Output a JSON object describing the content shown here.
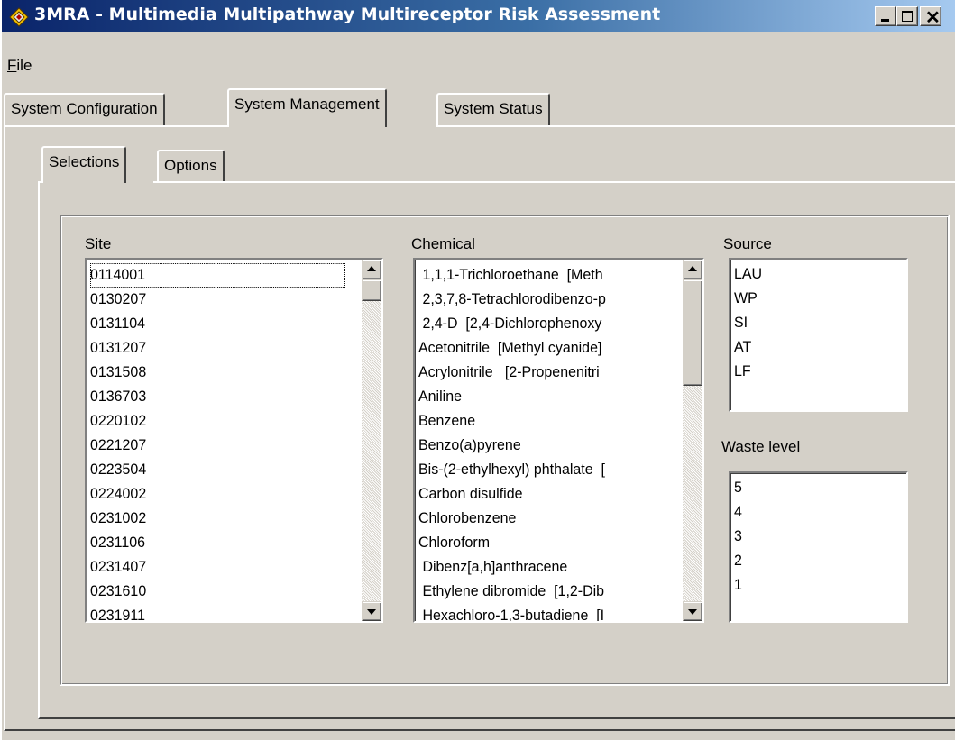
{
  "window": {
    "title": "3MRA - Multimedia Multipathway Multireceptor Risk Assessment",
    "icon": "diamond-app-icon"
  },
  "menu": {
    "file_prefix": "F",
    "file_rest": "ile"
  },
  "main_tabs": [
    "System Configuration",
    "System Management",
    "System Status"
  ],
  "main_tab_active": "System Management",
  "sub_tabs": [
    "Selections",
    "Options"
  ],
  "sub_tab_active": "Selections",
  "site": {
    "label": "Site",
    "items": [
      "0114001",
      "0130207",
      "0131104",
      "0131207",
      "0131508",
      "0136703",
      "0220102",
      "0221207",
      "0223504",
      "0224002",
      "0231002",
      "0231106",
      "0231407",
      "0231610",
      "0231911"
    ],
    "focused_item": "0114001"
  },
  "chemical": {
    "label": "Chemical",
    "items": [
      " 1,1,1-Trichloroethane  [Meth",
      " 2,3,7,8-Tetrachlorodibenzo-p",
      " 2,4-D  [2,4-Dichlorophenoxy",
      "Acetonitrile  [Methyl cyanide]",
      "Acrylonitrile   [2-Propenenitri",
      "Aniline",
      "Benzene",
      "Benzo(a)pyrene",
      "Bis-(2-ethylhexyl) phthalate  [",
      "Carbon disulfide",
      "Chlorobenzene",
      "Chloroform",
      " Dibenz[a,h]anthracene",
      " Ethylene dibromide  [1,2-Dib",
      " Hexachloro-1,3-butadiene  [I"
    ]
  },
  "source": {
    "label": "Source",
    "items": [
      "LAU",
      "WP",
      "SI",
      "AT",
      "LF"
    ]
  },
  "waste_level": {
    "label": "Waste level",
    "items": [
      "5",
      "4",
      "3",
      "2",
      "1"
    ]
  },
  "colors": {
    "face": "#d4d0c8",
    "title_start": "#0a246a",
    "title_end": "#a6caf0"
  }
}
